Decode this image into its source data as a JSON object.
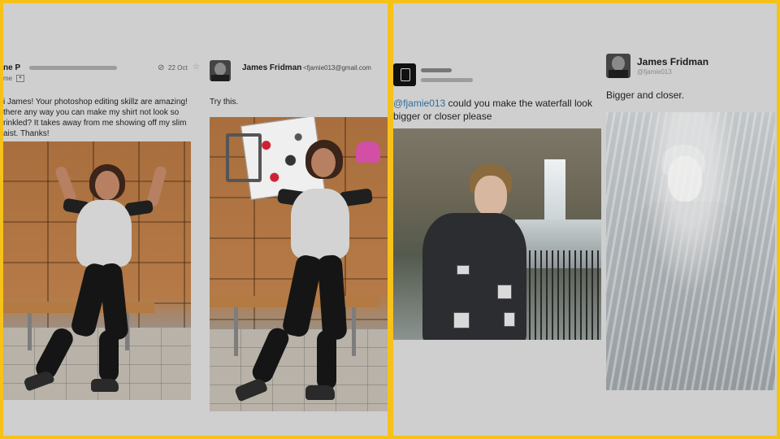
{
  "left": {
    "email": {
      "sender_fragment": "ne P",
      "to_fragment": "me",
      "date": "22 Oct",
      "body": "i James! Your photoshop editing skillz are amazing! there any way you can make my shirt not look so rinkled? It takes away from me showing off my slim aist. Thanks!",
      "star_icon": "star-icon",
      "attach_icon": "paperclip-icon"
    },
    "reply": {
      "name": "James Fridman",
      "email": "<fjamie013@gmail.com",
      "body": "Try this."
    }
  },
  "right": {
    "tweet": {
      "mention": "@fjamie013",
      "body": " could you make the waterfall look bigger or closer please"
    },
    "reply": {
      "name": "James Fridman",
      "handle": "@fjamie013",
      "body": "Bigger and closer."
    }
  }
}
